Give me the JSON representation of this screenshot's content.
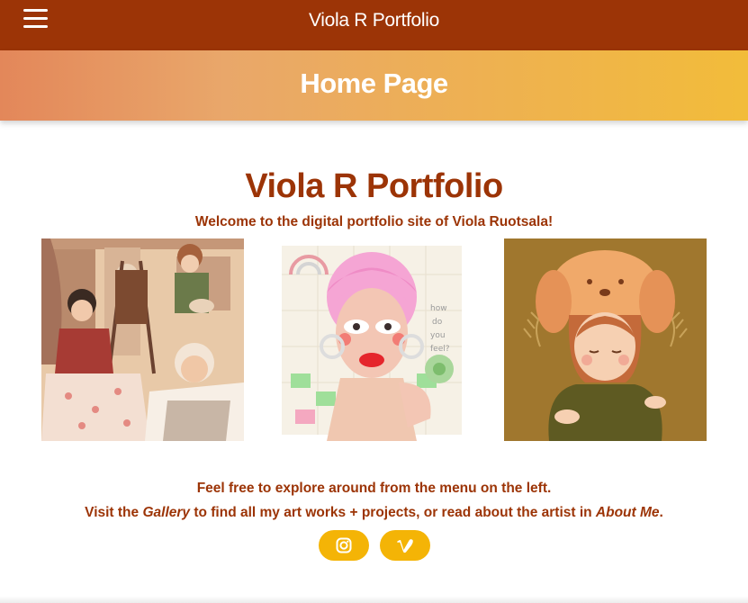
{
  "topbar": {
    "menu_icon": "hamburger-menu-icon",
    "site_title": "Viola R Portfolio",
    "background": "#9c3406"
  },
  "hero": {
    "title": "Home Page"
  },
  "main": {
    "title": "Viola R Portfolio",
    "welcome": "Welcome to the digital portfolio site of Viola Ruotsala!",
    "gallery_images": [
      {
        "icon": "artwork-three-figures-with-easel"
      },
      {
        "icon": "artwork-pink-haired-portrait"
      },
      {
        "icon": "artwork-girl-with-dog-hat"
      }
    ],
    "explore_text": "Feel free to explore around from the menu on the left.",
    "visit_prefix": "Visit the ",
    "gallery_link": "Gallery",
    "visit_middle": " to find all my art works + projects, or read about the artist in ",
    "about_link": "About Me",
    "visit_suffix": "."
  },
  "social": [
    {
      "icon": "instagram-icon"
    },
    {
      "icon": "vimeo-icon"
    }
  ],
  "colors": {
    "accent": "#9c3406",
    "button": "#f4b406",
    "hero_start": "#e3875a",
    "hero_end": "#f2bc3a"
  }
}
